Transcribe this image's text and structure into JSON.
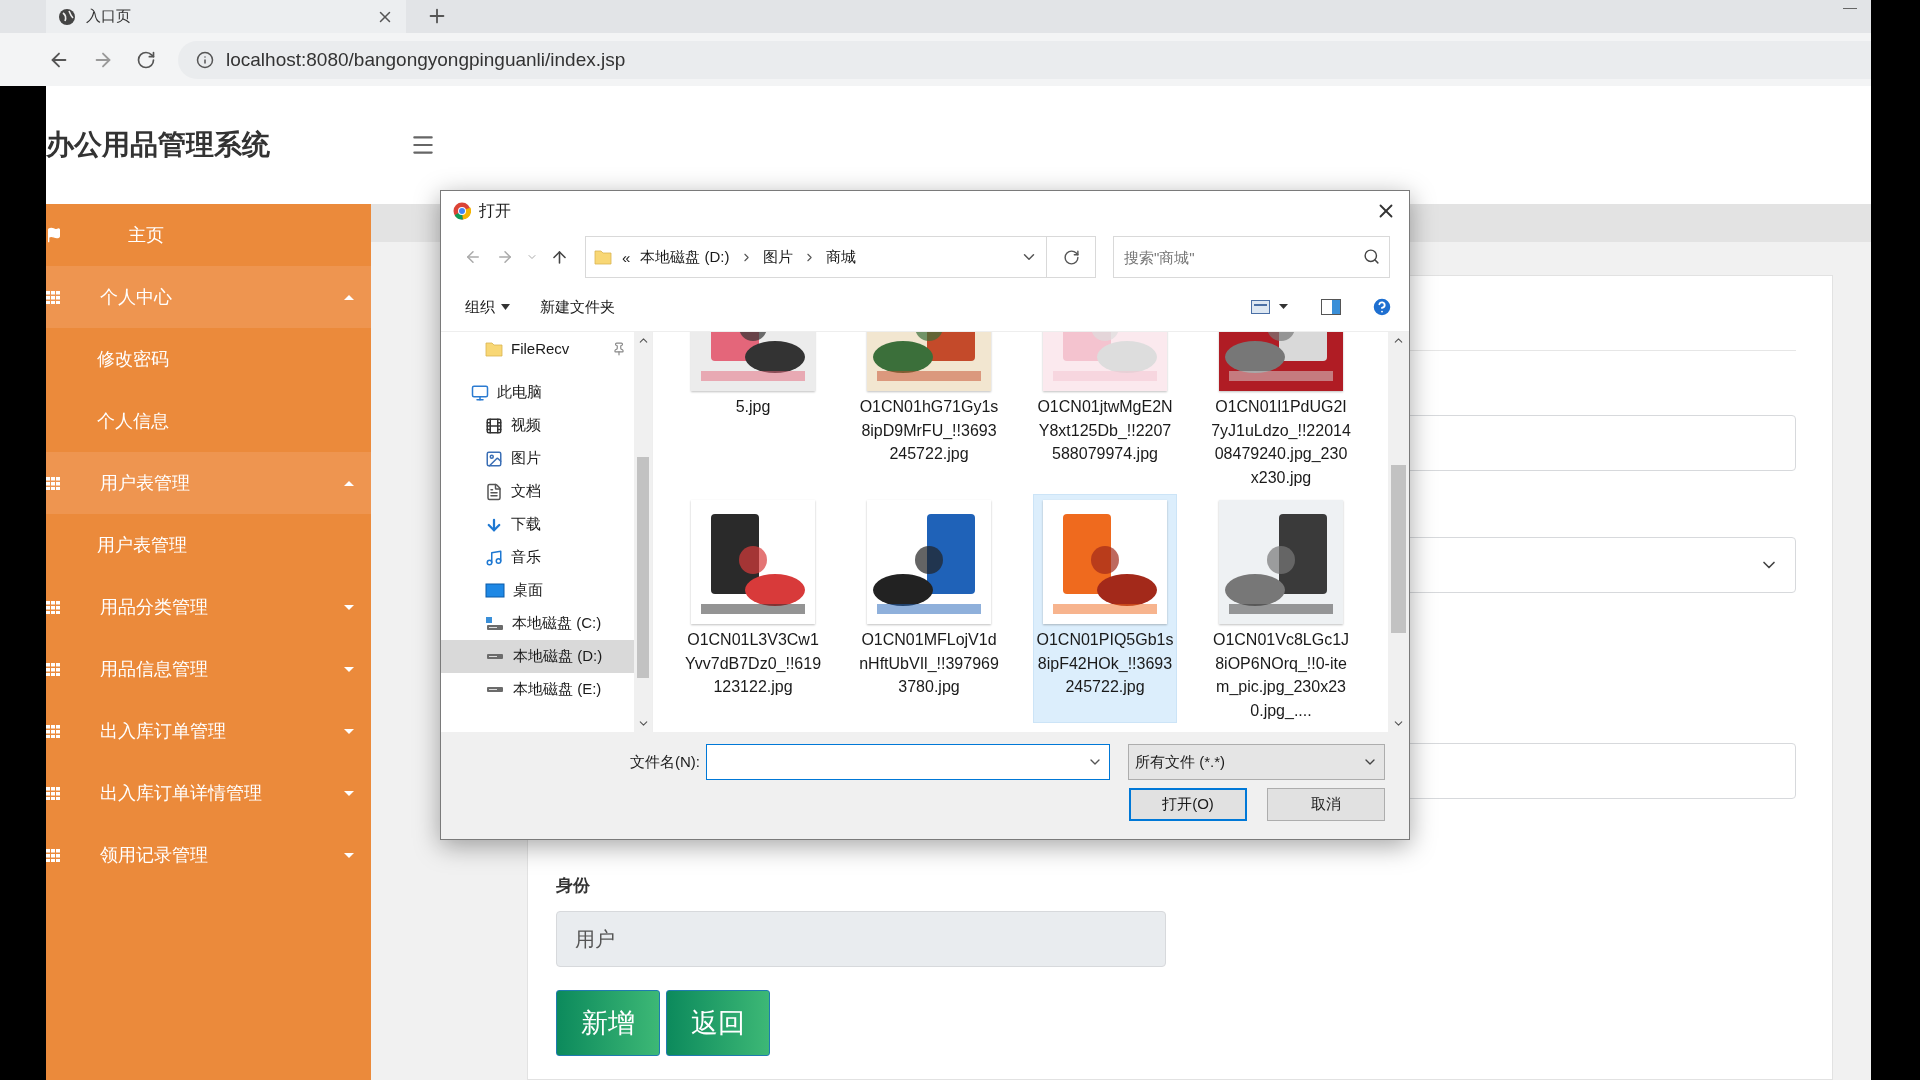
{
  "browser": {
    "tab_title": "入口页",
    "url": "localhost:8080/bangongyongpinguanli/index.jsp"
  },
  "app": {
    "title": "办公用品管理系统"
  },
  "sidebar": {
    "items": [
      {
        "kind": "link",
        "label": "主页"
      },
      {
        "kind": "group",
        "label": "个人中心",
        "expanded": true,
        "children": [
          {
            "label": "修改密码"
          },
          {
            "label": "个人信息"
          }
        ]
      },
      {
        "kind": "group",
        "label": "用户表管理",
        "expanded": true,
        "children": [
          {
            "label": "用户表管理"
          }
        ]
      },
      {
        "kind": "group",
        "label": "用品分类管理",
        "expanded": false
      },
      {
        "kind": "group",
        "label": "用品信息管理",
        "expanded": false
      },
      {
        "kind": "group",
        "label": "出入库订单管理",
        "expanded": false
      },
      {
        "kind": "group",
        "label": "出入库订单详情管理",
        "expanded": false
      },
      {
        "kind": "group",
        "label": "领用记录管理",
        "expanded": false
      }
    ]
  },
  "form": {
    "fields": [
      {
        "kind": "input",
        "disabled": false
      },
      {
        "kind": "select",
        "disabled": false
      },
      {
        "kind": "input",
        "disabled": false
      },
      {
        "kind": "input",
        "label": "身份",
        "value": "用户",
        "disabled": true
      }
    ],
    "buttons": [
      "新增",
      "返回"
    ]
  },
  "dialog": {
    "title": "打开",
    "overflow_marker": "«",
    "path": [
      "本地磁盘 (D:)",
      "图片",
      "商城"
    ],
    "search": {
      "placeholder": "搜索\"商城\""
    },
    "toolbar": {
      "organize": "组织",
      "new_folder": "新建文件夹"
    },
    "nav_pane": [
      {
        "kind": "folder",
        "label": "FileRecv",
        "pinned": true,
        "selected": false
      },
      {
        "kind": "pc",
        "label": "此电脑",
        "selected": false,
        "children": [
          {
            "kind": "video",
            "label": "视频",
            "selected": false
          },
          {
            "kind": "pictures",
            "label": "图片",
            "selected": false
          },
          {
            "kind": "documents",
            "label": "文档",
            "selected": false
          },
          {
            "kind": "downloads",
            "label": "下载",
            "selected": false
          },
          {
            "kind": "music",
            "label": "音乐",
            "selected": false
          },
          {
            "kind": "desktop",
            "label": "桌面",
            "selected": false
          },
          {
            "kind": "system-drive",
            "label": "本地磁盘 (C:)",
            "selected": false
          },
          {
            "kind": "drive",
            "label": "本地磁盘 (D:)",
            "selected": true
          },
          {
            "kind": "drive",
            "label": "本地磁盘 (E:)",
            "selected": false
          }
        ]
      }
    ],
    "files": [
      {
        "name": "5.jpg",
        "selected": false
      },
      {
        "name": "O1CN01hG71Gy1s8ipD9MrFU_!!3693245722.jpg",
        "selected": false
      },
      {
        "name": "O1CN01jtwMgE2NY8xt125Db_!!2207588079974.jpg",
        "selected": false
      },
      {
        "name": "O1CN01l1PdUG2I7yJ1uLdzo_!!2201408479240.jpg_230x230.jpg",
        "selected": false
      },
      {
        "name": "O1CN01L3V3Cw1Yvv7dB7Dz0_!!619123122.jpg",
        "selected": false
      },
      {
        "name": "O1CN01MFLojV1dnHftUbVIl_!!3979693780.jpg",
        "selected": false
      },
      {
        "name": "O1CN01PIQ5Gb1s8ipF42HOk_!!3693245722.jpg",
        "selected": true
      },
      {
        "name": "O1CN01Vc8LGc1J8iOP6NOrq_!!0-item_pic.jpg_230x230.jpg_....",
        "selected": false
      }
    ],
    "footer": {
      "filename_label": "文件名(N):",
      "filetype": "所有文件 (*.*)",
      "buttons": [
        "打开(O)",
        "取消"
      ]
    }
  }
}
